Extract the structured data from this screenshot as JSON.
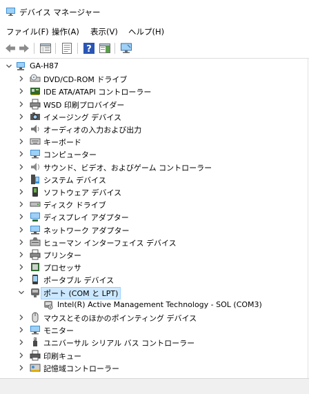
{
  "window": {
    "title": "デバイス マネージャー"
  },
  "menu": [
    "ファイル(F)",
    "操作(A)",
    "表示(V)",
    "ヘルプ(H)"
  ],
  "toolbar": [
    "back-icon",
    "forward-icon",
    "show-hide-tree-icon",
    "properties-icon",
    "help-icon",
    "action-pane-icon",
    "monitor-scan-icon"
  ],
  "tree": {
    "root": "GA-H87",
    "categories": [
      {
        "label": "DVD/CD-ROM ドライブ",
        "icon": "dvd-drive-icon"
      },
      {
        "label": "IDE ATA/ATAPI コントローラー",
        "icon": "ide-controller-icon"
      },
      {
        "label": "WSD 印刷プロバイダー",
        "icon": "printer-icon"
      },
      {
        "label": "イメージング デバイス",
        "icon": "camera-icon"
      },
      {
        "label": "オーディオの入力および出力",
        "icon": "speaker-icon"
      },
      {
        "label": "キーボード",
        "icon": "keyboard-icon"
      },
      {
        "label": "コンピューター",
        "icon": "computer-icon"
      },
      {
        "label": "サウンド、ビデオ、およびゲーム コントローラー",
        "icon": "sound-icon"
      },
      {
        "label": "システム デバイス",
        "icon": "system-device-icon"
      },
      {
        "label": "ソフトウェア デバイス",
        "icon": "software-device-icon"
      },
      {
        "label": "ディスク ドライブ",
        "icon": "disk-drive-icon"
      },
      {
        "label": "ディスプレイ アダプター",
        "icon": "display-adapter-icon"
      },
      {
        "label": "ネットワーク アダプター",
        "icon": "network-adapter-icon"
      },
      {
        "label": "ヒューマン インターフェイス デバイス",
        "icon": "hid-icon"
      },
      {
        "label": "プリンター",
        "icon": "printer-icon"
      },
      {
        "label": "プロセッサ",
        "icon": "processor-icon"
      },
      {
        "label": "ポータブル デバイス",
        "icon": "portable-device-icon"
      },
      {
        "label": "ポート (COM と LPT)",
        "icon": "port-icon",
        "expanded": true,
        "selected": true,
        "children": [
          {
            "label": "Intel(R) Active Management Technology - SOL (COM3)",
            "icon": "port-device-icon"
          }
        ]
      },
      {
        "label": "マウスとそのほかのポインティング デバイス",
        "icon": "mouse-icon"
      },
      {
        "label": "モニター",
        "icon": "monitor-icon"
      },
      {
        "label": "ユニバーサル シリアル バス コントローラー",
        "icon": "usb-icon"
      },
      {
        "label": "印刷キュー",
        "icon": "print-queue-icon"
      },
      {
        "label": "記憶域コントローラー",
        "icon": "storage-controller-icon"
      }
    ]
  }
}
